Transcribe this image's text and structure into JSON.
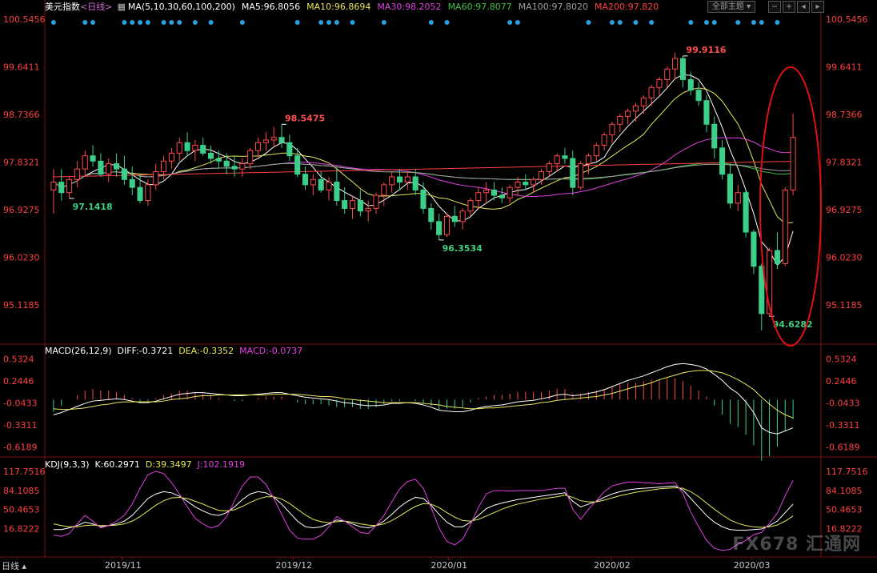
{
  "header": {
    "symbol": "美元指数",
    "period": "<日线>",
    "ma_params": "MA(5,10,30,60,100,200)",
    "ma5": "MA5:96.8056",
    "ma10": "MA10:96.8694",
    "ma30": "MA30:98.2052",
    "ma60": "MA60:97.8077",
    "ma100": "MA100:97.8020",
    "ma200": "MA200:97.820",
    "theme_button": "全部主题",
    "colors": {
      "ma5": "#ffffff",
      "ma10": "#e8e85a",
      "ma30": "#e040e0",
      "ma60": "#40c040",
      "ma100": "#a0a0a0",
      "ma200": "#ff4040"
    }
  },
  "macd_header": {
    "title": "MACD(26,12,9)",
    "diff": "DIFF:-0.3721",
    "dea": "DEA:-0.3352",
    "macd": "MACD:-0.0737"
  },
  "kdj_header": {
    "title": "KDJ(9,3,3)",
    "k": "K:60.2971",
    "d": "D:39.3497",
    "j": "J:102.1919"
  },
  "footer": {
    "period_label": "日线"
  },
  "watermark": "FX678 汇通网",
  "chart_data": {
    "type": "candlestick",
    "price_ticks": [
      "100.5456",
      "99.6411",
      "98.7366",
      "97.8321",
      "96.9275",
      "96.0230",
      "95.1185"
    ],
    "macd_ticks": [
      "0.5324",
      "0.2446",
      "-0.0433",
      "-0.3311",
      "-0.6189"
    ],
    "kdj_ticks": [
      "117.7516",
      "84.1085",
      "50.4653",
      "16.8222"
    ],
    "x_ticks": [
      "2019/11",
      "2019/12",
      "2020/01",
      "2020/02",
      "2020/03"
    ],
    "annotations": [
      {
        "text": "98.5475",
        "type": "high"
      },
      {
        "text": "97.1418",
        "type": "low"
      },
      {
        "text": "96.3534",
        "type": "low"
      },
      {
        "text": "99.9116",
        "type": "high"
      },
      {
        "text": "94.6282",
        "type": "low"
      }
    ],
    "candles": [
      [
        97.3,
        97.7,
        96.85,
        97.45
      ],
      [
        97.45,
        97.7,
        97.1,
        97.25
      ],
      [
        97.25,
        97.55,
        97.14,
        97.5
      ],
      [
        97.5,
        97.85,
        97.35,
        97.7
      ],
      [
        97.7,
        98.05,
        97.55,
        97.95
      ],
      [
        97.95,
        98.15,
        97.75,
        97.85
      ],
      [
        97.85,
        98.0,
        97.55,
        97.6
      ],
      [
        97.6,
        97.9,
        97.45,
        97.8
      ],
      [
        97.8,
        98.0,
        97.55,
        97.7
      ],
      [
        97.7,
        97.95,
        97.4,
        97.5
      ],
      [
        97.5,
        97.75,
        97.2,
        97.35
      ],
      [
        97.35,
        97.6,
        97.05,
        97.1
      ],
      [
        97.1,
        97.5,
        97.0,
        97.4
      ],
      [
        97.4,
        97.8,
        97.3,
        97.65
      ],
      [
        97.65,
        97.95,
        97.5,
        97.85
      ],
      [
        97.85,
        98.1,
        97.7,
        98.0
      ],
      [
        98.0,
        98.3,
        97.85,
        98.2
      ],
      [
        98.2,
        98.4,
        97.95,
        98.05
      ],
      [
        98.05,
        98.25,
        97.85,
        98.15
      ],
      [
        98.15,
        98.3,
        97.95,
        98.0
      ],
      [
        98.0,
        98.15,
        97.8,
        97.9
      ],
      [
        97.9,
        98.05,
        97.7,
        97.85
      ],
      [
        97.85,
        98.0,
        97.6,
        97.75
      ],
      [
        97.75,
        97.95,
        97.55,
        97.7
      ],
      [
        97.7,
        97.9,
        97.55,
        97.8
      ],
      [
        97.8,
        98.1,
        97.7,
        98.05
      ],
      [
        98.05,
        98.3,
        97.9,
        98.2
      ],
      [
        98.2,
        98.4,
        98.05,
        98.25
      ],
      [
        98.25,
        98.5,
        98.1,
        98.3
      ],
      [
        98.3,
        98.55,
        98.1,
        98.2
      ],
      [
        98.2,
        98.35,
        97.85,
        97.95
      ],
      [
        97.95,
        98.1,
        97.55,
        97.6
      ],
      [
        97.6,
        97.75,
        97.3,
        97.4
      ],
      [
        97.4,
        97.6,
        97.2,
        97.5
      ],
      [
        97.5,
        97.65,
        97.25,
        97.3
      ],
      [
        97.3,
        97.55,
        97.1,
        97.45
      ],
      [
        97.45,
        97.7,
        97.0,
        97.1
      ],
      [
        97.1,
        97.35,
        96.85,
        96.95
      ],
      [
        96.95,
        97.2,
        96.75,
        97.1
      ],
      [
        97.1,
        97.3,
        96.8,
        96.9
      ],
      [
        96.9,
        97.1,
        96.7,
        96.95
      ],
      [
        96.95,
        97.25,
        96.85,
        97.2
      ],
      [
        97.2,
        97.45,
        97.0,
        97.4
      ],
      [
        97.4,
        97.65,
        97.25,
        97.55
      ],
      [
        97.55,
        97.7,
        97.3,
        97.45
      ],
      [
        97.45,
        97.65,
        97.3,
        97.55
      ],
      [
        97.55,
        97.7,
        97.2,
        97.3
      ],
      [
        97.3,
        97.45,
        96.85,
        96.95
      ],
      [
        96.95,
        97.05,
        96.55,
        96.7
      ],
      [
        96.7,
        96.85,
        96.35,
        96.45
      ],
      [
        96.45,
        96.85,
        96.4,
        96.8
      ],
      [
        96.8,
        97.0,
        96.6,
        96.7
      ],
      [
        96.7,
        96.95,
        96.55,
        96.9
      ],
      [
        96.9,
        97.15,
        96.8,
        97.1
      ],
      [
        97.1,
        97.35,
        96.95,
        97.25
      ],
      [
        97.25,
        97.45,
        97.05,
        97.3
      ],
      [
        97.3,
        97.45,
        97.1,
        97.2
      ],
      [
        97.2,
        97.35,
        97.05,
        97.15
      ],
      [
        97.15,
        97.4,
        97.05,
        97.35
      ],
      [
        97.35,
        97.55,
        97.2,
        97.45
      ],
      [
        97.45,
        97.6,
        97.3,
        97.4
      ],
      [
        97.4,
        97.55,
        97.25,
        97.5
      ],
      [
        97.5,
        97.7,
        97.4,
        97.65
      ],
      [
        97.65,
        97.85,
        97.55,
        97.8
      ],
      [
        97.8,
        98.0,
        97.65,
        97.95
      ],
      [
        97.95,
        98.1,
        97.8,
        97.9
      ],
      [
        97.9,
        98.05,
        97.2,
        97.35
      ],
      [
        97.35,
        97.85,
        97.3,
        97.8
      ],
      [
        97.8,
        98.0,
        97.6,
        97.95
      ],
      [
        97.95,
        98.2,
        97.85,
        98.15
      ],
      [
        98.15,
        98.4,
        98.05,
        98.35
      ],
      [
        98.35,
        98.6,
        98.2,
        98.55
      ],
      [
        98.55,
        98.75,
        98.4,
        98.7
      ],
      [
        98.7,
        98.85,
        98.55,
        98.8
      ],
      [
        98.8,
        98.95,
        98.6,
        98.9
      ],
      [
        98.9,
        99.1,
        98.75,
        99.05
      ],
      [
        99.05,
        99.3,
        98.9,
        99.25
      ],
      [
        99.25,
        99.45,
        99.1,
        99.4
      ],
      [
        99.4,
        99.65,
        99.25,
        99.6
      ],
      [
        99.6,
        99.91,
        99.4,
        99.8
      ],
      [
        99.8,
        99.85,
        99.25,
        99.4
      ],
      [
        99.4,
        99.55,
        99.1,
        99.2
      ],
      [
        99.2,
        99.35,
        98.9,
        99.0
      ],
      [
        99.0,
        99.1,
        98.4,
        98.55
      ],
      [
        98.55,
        98.7,
        97.9,
        98.1
      ],
      [
        98.1,
        98.25,
        97.5,
        97.6
      ],
      [
        97.6,
        97.8,
        96.95,
        97.05
      ],
      [
        97.05,
        97.4,
        96.9,
        97.25
      ],
      [
        97.25,
        97.3,
        96.4,
        96.5
      ],
      [
        96.5,
        96.55,
        95.7,
        95.85
      ],
      [
        95.85,
        95.9,
        94.63,
        94.95
      ],
      [
        94.95,
        96.2,
        94.9,
        96.15
      ],
      [
        96.15,
        96.5,
        95.8,
        95.9
      ],
      [
        95.9,
        97.35,
        95.85,
        97.3
      ],
      [
        97.3,
        98.75,
        97.2,
        98.3
      ]
    ],
    "macd": {
      "diff": [
        -0.2,
        -0.17,
        -0.13,
        -0.09,
        -0.05,
        -0.02,
        -0.01,
        0.0,
        0.01,
        0.0,
        -0.02,
        -0.04,
        -0.04,
        -0.02,
        0.01,
        0.04,
        0.07,
        0.08,
        0.09,
        0.09,
        0.08,
        0.07,
        0.06,
        0.05,
        0.05,
        0.06,
        0.07,
        0.08,
        0.09,
        0.09,
        0.07,
        0.05,
        0.03,
        0.02,
        0.01,
        0.0,
        -0.02,
        -0.04,
        -0.05,
        -0.07,
        -0.08,
        -0.08,
        -0.07,
        -0.05,
        -0.05,
        -0.04,
        -0.05,
        -0.07,
        -0.1,
        -0.14,
        -0.15,
        -0.16,
        -0.16,
        -0.14,
        -0.11,
        -0.09,
        -0.08,
        -0.07,
        -0.05,
        -0.03,
        -0.02,
        -0.01,
        0.01,
        0.03,
        0.06,
        0.07,
        0.05,
        0.06,
        0.08,
        0.1,
        0.13,
        0.17,
        0.21,
        0.25,
        0.28,
        0.31,
        0.35,
        0.39,
        0.43,
        0.46,
        0.47,
        0.46,
        0.44,
        0.4,
        0.33,
        0.25,
        0.15,
        0.08,
        -0.03,
        -0.17,
        -0.37,
        -0.43,
        -0.45,
        -0.41,
        -0.37
      ],
      "dea": [
        -0.12,
        -0.13,
        -0.13,
        -0.12,
        -0.11,
        -0.09,
        -0.07,
        -0.06,
        -0.04,
        -0.03,
        -0.03,
        -0.03,
        -0.03,
        -0.03,
        -0.02,
        0.0,
        0.01,
        0.02,
        0.04,
        0.05,
        0.05,
        0.06,
        0.06,
        0.06,
        0.06,
        0.06,
        0.06,
        0.06,
        0.07,
        0.07,
        0.07,
        0.07,
        0.06,
        0.05,
        0.04,
        0.04,
        0.03,
        0.01,
        0.0,
        -0.01,
        -0.02,
        -0.03,
        -0.04,
        -0.04,
        -0.04,
        -0.04,
        -0.04,
        -0.05,
        -0.06,
        -0.07,
        -0.09,
        -0.1,
        -0.11,
        -0.12,
        -0.12,
        -0.11,
        -0.11,
        -0.1,
        -0.09,
        -0.08,
        -0.07,
        -0.06,
        -0.04,
        -0.03,
        -0.01,
        0.0,
        0.01,
        0.02,
        0.03,
        0.04,
        0.06,
        0.08,
        0.11,
        0.14,
        0.17,
        0.19,
        0.22,
        0.26,
        0.29,
        0.32,
        0.35,
        0.37,
        0.38,
        0.38,
        0.37,
        0.35,
        0.31,
        0.26,
        0.2,
        0.13,
        0.03,
        -0.06,
        -0.14,
        -0.2,
        -0.24
      ]
    },
    "kdj": {
      "k": [
        15,
        15,
        18,
        22,
        28,
        25,
        20,
        22,
        25,
        30,
        40,
        55,
        70,
        78,
        82,
        80,
        74,
        65,
        55,
        48,
        42,
        40,
        45,
        55,
        68,
        78,
        82,
        80,
        72,
        60,
        45,
        30,
        20,
        18,
        20,
        25,
        32,
        30,
        25,
        20,
        18,
        22,
        30,
        42,
        55,
        65,
        72,
        70,
        58,
        42,
        28,
        20,
        20,
        28,
        40,
        52,
        58,
        62,
        65,
        68,
        70,
        72,
        74,
        76,
        78,
        80,
        65,
        55,
        60,
        65,
        72,
        78,
        82,
        85,
        87,
        88,
        89,
        90,
        91,
        92,
        85,
        70,
        55,
        40,
        28,
        20,
        15,
        14,
        14,
        15,
        16,
        22,
        30,
        45,
        60
      ],
      "d": [
        25,
        22,
        20,
        20,
        22,
        23,
        22,
        22,
        23,
        25,
        30,
        38,
        48,
        58,
        66,
        71,
        72,
        70,
        65,
        60,
        54,
        49,
        48,
        50,
        56,
        63,
        69,
        73,
        73,
        69,
        61,
        51,
        41,
        33,
        29,
        27,
        29,
        30,
        28,
        25,
        23,
        22,
        25,
        31,
        39,
        48,
        56,
        61,
        60,
        54,
        45,
        37,
        31,
        30,
        33,
        39,
        45,
        51,
        56,
        60,
        63,
        66,
        69,
        71,
        73,
        76,
        72,
        66,
        64,
        64,
        67,
        71,
        75,
        78,
        81,
        83,
        85,
        87,
        88,
        89,
        88,
        82,
        73,
        62,
        51,
        41,
        32,
        26,
        22,
        20,
        19,
        20,
        23,
        30,
        39
      ],
      "j": [
        5,
        3,
        8,
        25,
        40,
        30,
        18,
        22,
        30,
        40,
        60,
        88,
        112,
        118,
        114,
        98,
        78,
        55,
        35,
        25,
        18,
        22,
        38,
        66,
        92,
        108,
        108,
        95,
        70,
        42,
        14,
        0,
        -2,
        -2,
        5,
        20,
        38,
        30,
        20,
        10,
        8,
        22,
        40,
        64,
        87,
        100,
        104,
        88,
        54,
        18,
        -6,
        -12,
        -2,
        24,
        54,
        78,
        84,
        84,
        83,
        84,
        84,
        84,
        84,
        86,
        88,
        88,
        51,
        33,
        51,
        66,
        82,
        92,
        96,
        99,
        99,
        98,
        97,
        96,
        97,
        98,
        79,
        46,
        20,
        -4,
        -18,
        -22,
        -20,
        -11,
        -4,
        6,
        10,
        26,
        44,
        75,
        102
      ]
    }
  }
}
